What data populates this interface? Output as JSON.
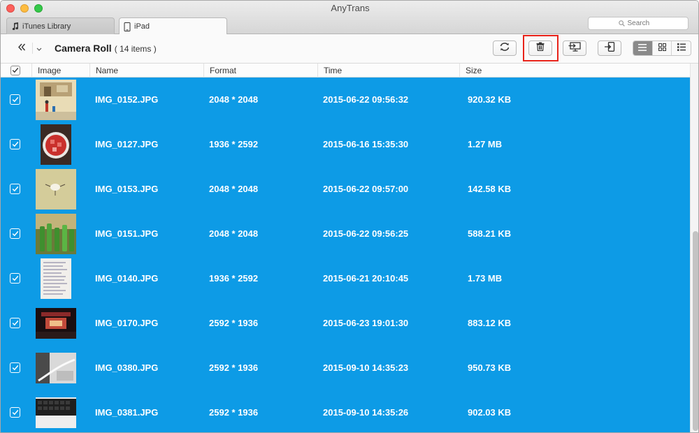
{
  "window": {
    "title": "AnyTrans"
  },
  "tabs": [
    {
      "label": "iTunes Library",
      "icon": "music-note-icon"
    },
    {
      "label": "iPad",
      "icon": "ipad-icon"
    }
  ],
  "search": {
    "placeholder": "Search"
  },
  "breadcrumb": {
    "title": "Camera Roll",
    "count": "( 14 items )"
  },
  "toolbar": {
    "buttons": [
      "refresh-icon",
      "trash-icon",
      "send-to-computer-icon",
      "send-to-device-icon"
    ],
    "views": [
      "list-view-icon",
      "grid-view-icon",
      "detail-view-icon"
    ],
    "active_view": "list-view-icon",
    "highlight_color": "#e8231a"
  },
  "table": {
    "columns": [
      "Image",
      "Name",
      "Format",
      "Time",
      "Size"
    ],
    "selection_color": "#0d9be6",
    "rows": [
      {
        "name": "IMG_0152.JPG",
        "format": "2048 * 2048",
        "time": "2015-06-22 09:56:32",
        "size": "920.32 KB",
        "thumb": "street-scene"
      },
      {
        "name": "IMG_0127.JPG",
        "format": "1936 * 2592",
        "time": "2015-06-16 15:35:30",
        "size": "1.27 MB",
        "thumb": "food-plate"
      },
      {
        "name": "IMG_0153.JPG",
        "format": "2048 * 2048",
        "time": "2015-06-22 09:57:00",
        "size": "142.58 KB",
        "thumb": "bird-drawing"
      },
      {
        "name": "IMG_0151.JPG",
        "format": "2048 * 2048",
        "time": "2015-06-22 09:56:25",
        "size": "588.21 KB",
        "thumb": "green-bottles"
      },
      {
        "name": "IMG_0140.JPG",
        "format": "1936 * 2592",
        "time": "2015-06-21 20:10:45",
        "size": "1.73 MB",
        "thumb": "handwritten-note"
      },
      {
        "name": "IMG_0170.JPG",
        "format": "2592 * 1936",
        "time": "2015-06-23 19:01:30",
        "size": "883.12 KB",
        "thumb": "night-stage"
      },
      {
        "name": "IMG_0380.JPG",
        "format": "2592 * 1936",
        "time": "2015-09-10 14:35:23",
        "size": "950.73 KB",
        "thumb": "laptop-cable"
      },
      {
        "name": "IMG_0381.JPG",
        "format": "2592 * 1936",
        "time": "2015-09-10 14:35:26",
        "size": "902.03 KB",
        "thumb": "keyboard"
      }
    ]
  }
}
